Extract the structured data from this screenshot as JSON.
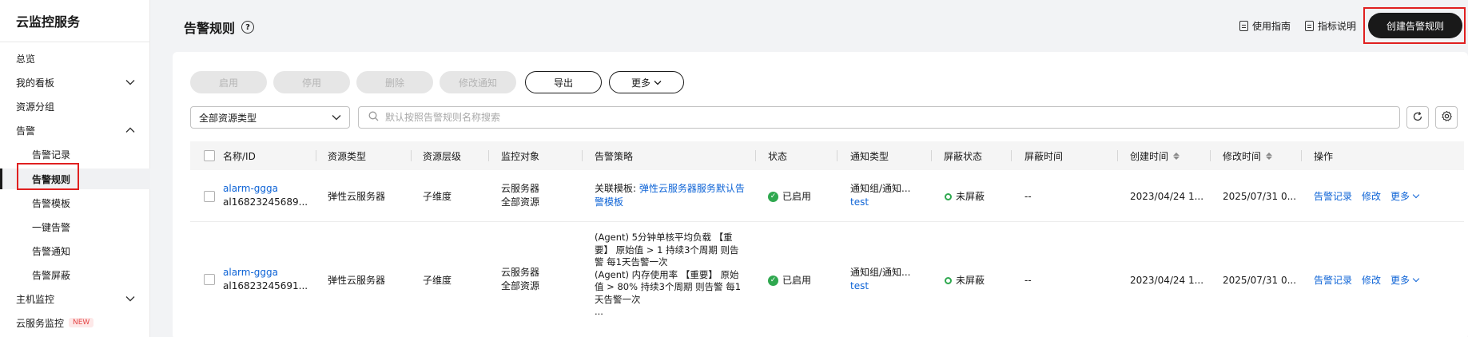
{
  "sidebar": {
    "title": "云监控服务",
    "items": [
      {
        "label": "总览"
      },
      {
        "label": "我的看板"
      },
      {
        "label": "资源分组"
      },
      {
        "label": "告警"
      },
      {
        "label": "告警记录"
      },
      {
        "label": "告警规则"
      },
      {
        "label": "告警模板"
      },
      {
        "label": "一键告警"
      },
      {
        "label": "告警通知"
      },
      {
        "label": "告警屏蔽"
      },
      {
        "label": "主机监控"
      },
      {
        "label": "云服务监控",
        "badge": "NEW"
      }
    ]
  },
  "header": {
    "title": "告警规则",
    "help": "?",
    "guide_label": "使用指南",
    "metric_label": "指标说明",
    "create_label": "创建告警规则"
  },
  "toolbar": {
    "enable": "启用",
    "disable": "停用",
    "delete": "删除",
    "modify_notify": "修改通知",
    "export": "导出",
    "more": "更多"
  },
  "filter": {
    "resource_type": "全部资源类型",
    "search_placeholder": "默认按照告警规则名称搜索"
  },
  "table": {
    "columns": [
      "名称/ID",
      "资源类型",
      "资源层级",
      "监控对象",
      "告警策略",
      "状态",
      "通知类型",
      "屏蔽状态",
      "屏蔽时间",
      "创建时间",
      "修改时间",
      "操作"
    ],
    "rows": [
      {
        "name": "alarm-ggga",
        "id": "al16823245689...",
        "resource_type": "弹性云服务器",
        "level": "子维度",
        "target_line1": "云服务器",
        "target_line2": "全部资源",
        "policy_prefix": "关联模板: ",
        "policy_link_line1": "弹性云服务器服务默认告",
        "policy_link_line2": "警模板",
        "status": "已启用",
        "notify_type": "通知组/通知...",
        "notify_link": "test",
        "mask_status": "未屏蔽",
        "mask_time": "--",
        "created": "2023/04/24 1...",
        "modified": "2025/07/31 0...",
        "op_records": "告警记录",
        "op_modify": "修改",
        "op_more": "更多"
      },
      {
        "name": "alarm-ggga",
        "id": "al16823245691...",
        "resource_type": "弹性云服务器",
        "level": "子维度",
        "target_line1": "云服务器",
        "target_line2": "全部资源",
        "policy_lines": [
          "(Agent) 5分钟单核平均负载 【重",
          "要】 原始值 > 1 持续3个周期 则告",
          "警 每1天告警一次",
          "(Agent) 内存使用率 【重要】 原始",
          "值 > 80% 持续3个周期 则告警 每1",
          "天告警一次",
          "..."
        ],
        "status": "已启用",
        "notify_type": "通知组/通知...",
        "notify_link": "test",
        "mask_status": "未屏蔽",
        "mask_time": "--",
        "created": "2023/04/24 1...",
        "modified": "2025/07/31 0...",
        "op_records": "告警记录",
        "op_modify": "修改",
        "op_more": "更多"
      }
    ]
  }
}
